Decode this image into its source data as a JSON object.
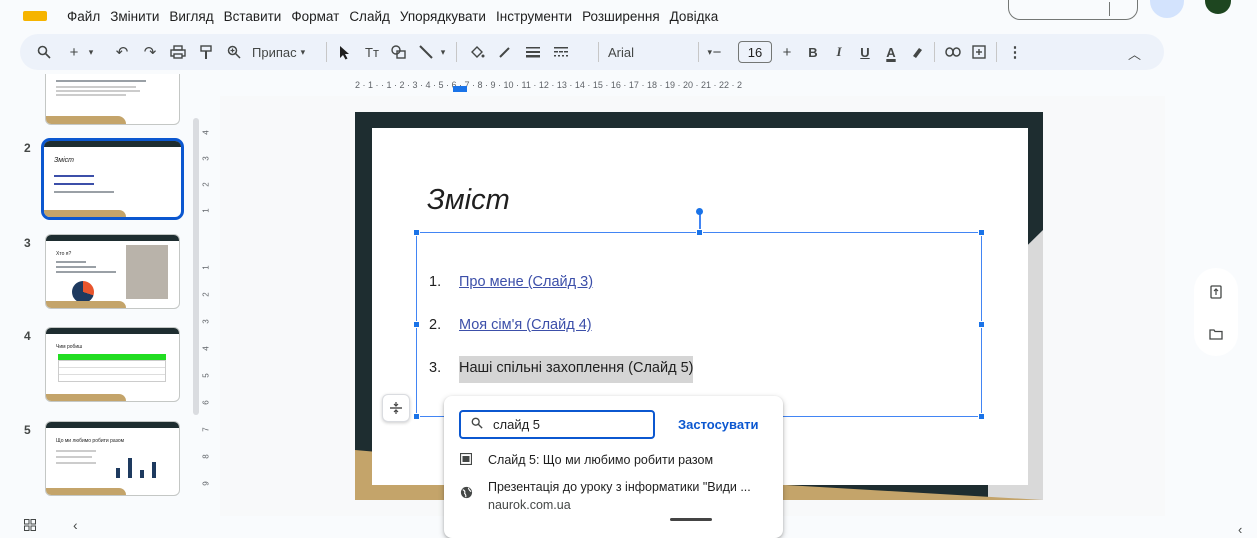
{
  "menu": {
    "items": [
      "Файл",
      "Змінити",
      "Вигляд",
      "Вставити",
      "Формат",
      "Слайд",
      "Упорядкувати",
      "Інструменти",
      "Розширення",
      "Довідка"
    ]
  },
  "toolbar": {
    "zoom_label": "Припас",
    "font_name": "Arial",
    "font_size": "16",
    "bold": "B",
    "italic": "I",
    "underline": "U",
    "text_color": "A",
    "more": "⋮"
  },
  "slides_panel": {
    "numbers": [
      "2",
      "3",
      "4",
      "5"
    ],
    "thumb_titles": [
      "Зміст",
      "Хто я?",
      "Чим робиш",
      "Що ми любимо робити разом"
    ]
  },
  "ruler": {
    "horizontal": "2 · 1 · · 1 · 2 · 3 · 4 · 5 · 6 · 7 · 8 · 9 · 10 · 11 · 12 · 13 · 14 · 15 · 16 · 17 · 18 · 19 · 20 · 21 · 22 · 2",
    "vertical": [
      "4",
      "3",
      "2",
      "1",
      "1",
      "2",
      "3",
      "4",
      "5",
      "6",
      "7",
      "8",
      "9"
    ]
  },
  "slide": {
    "title": "Зміст",
    "items": [
      {
        "num": "1.",
        "text": "Про мене (Слайд 3)"
      },
      {
        "num": "2.",
        "text": "Моя сім'я (Слайд 4)"
      },
      {
        "num": "3.",
        "text": "Наші спільні захоплення (Слайд 5)"
      }
    ]
  },
  "link_popup": {
    "search_value": "слайд 5",
    "apply_label": "Застосувати",
    "suggestions": [
      {
        "icon": "slide-icon",
        "title": "Слайд 5: Що ми любимо робити разом",
        "subtitle": ""
      },
      {
        "icon": "globe-icon",
        "title": "Презентація до уроку з інформатики \"Види ...",
        "subtitle": "naurok.com.ua"
      }
    ]
  },
  "colors": {
    "accent": "#0b57d0",
    "slide_dark": "#1e2d30",
    "slide_gold": "#c4a46a",
    "link": "#3c4fa9"
  }
}
